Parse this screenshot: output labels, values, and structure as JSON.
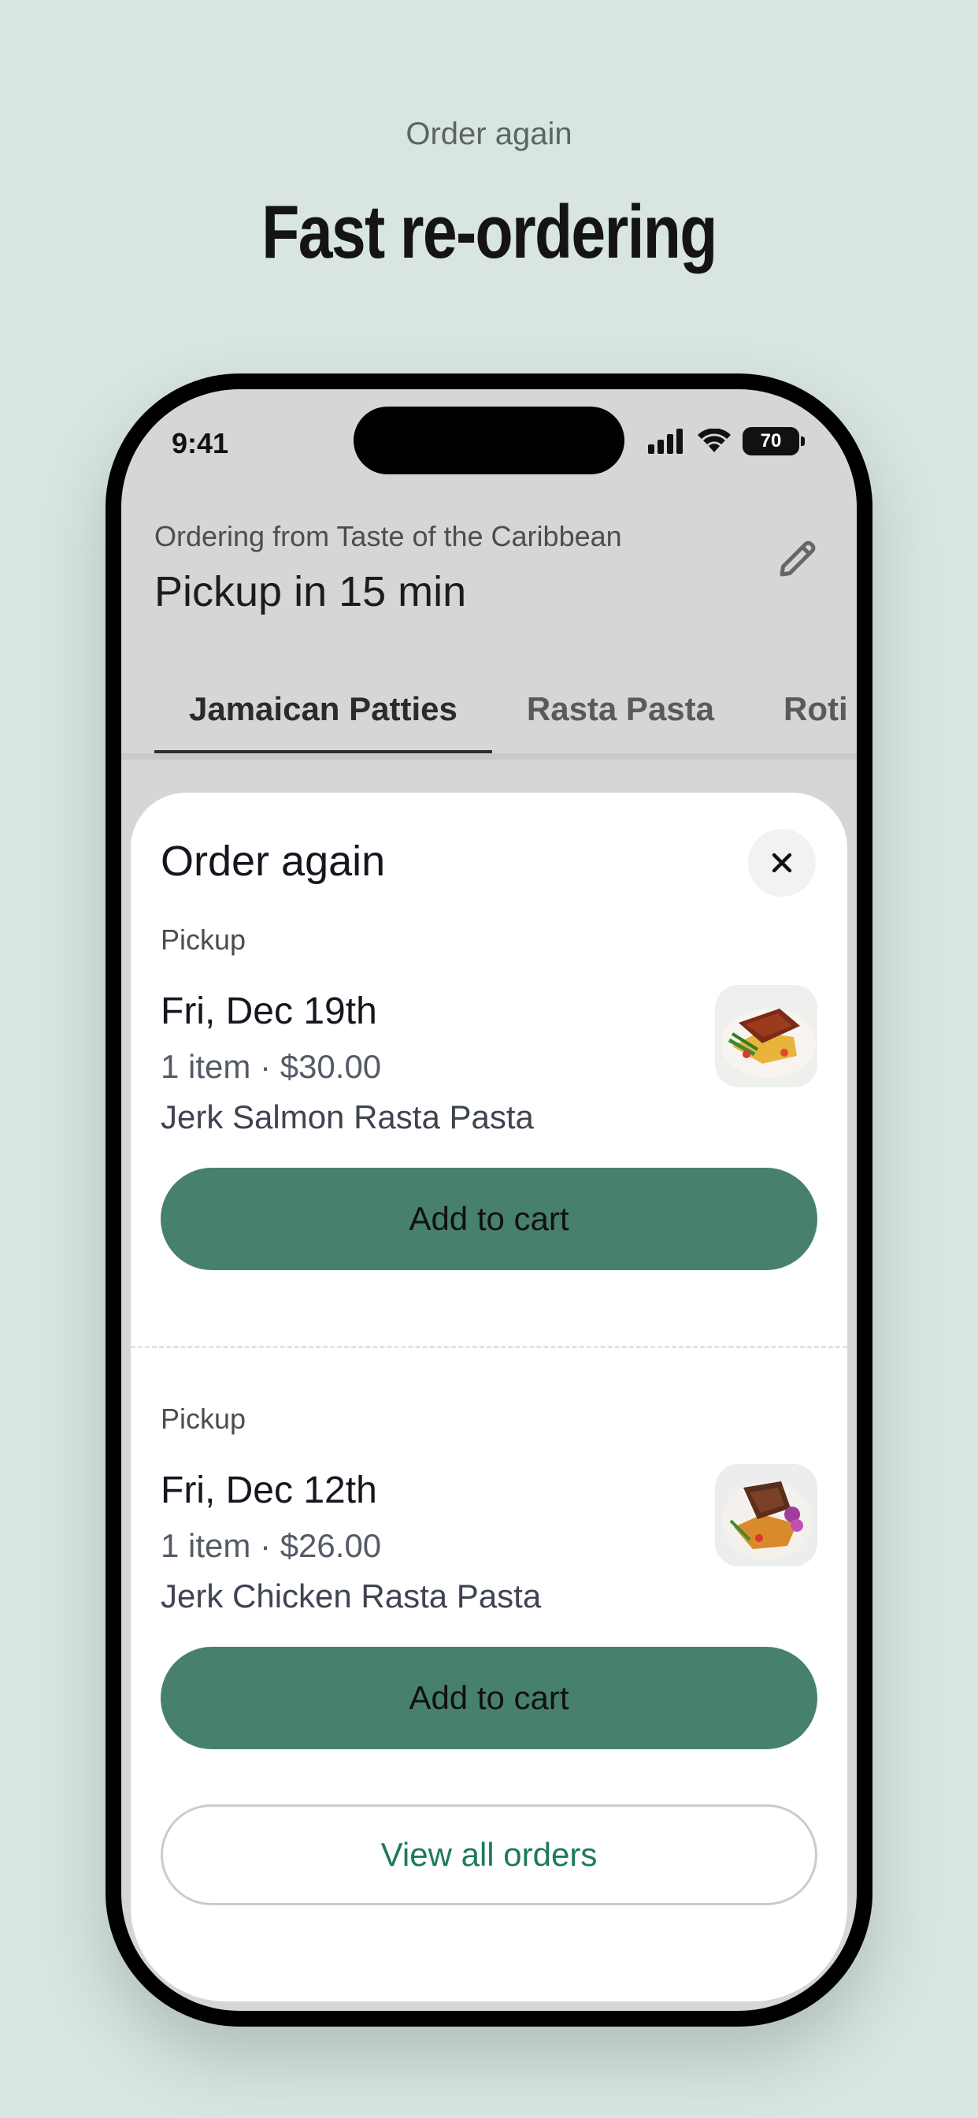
{
  "header": {
    "eyebrow": "Order again",
    "headline": "Fast re-ordering"
  },
  "status_bar": {
    "time": "9:41",
    "battery": "70"
  },
  "store": {
    "ordering_from": "Ordering from Taste of the Caribbean",
    "pickup_title": "Pickup in 15 min"
  },
  "tabs": [
    {
      "label": "Jamaican Patties",
      "active": true
    },
    {
      "label": "Rasta Pasta",
      "active": false
    },
    {
      "label": "Roti",
      "active": false
    }
  ],
  "sheet": {
    "title": "Order again",
    "orders": [
      {
        "type": "Pickup",
        "date": "Fri, Dec 19th",
        "meta": "1 item · $30.00",
        "item": "Jerk Salmon Rasta Pasta",
        "button": "Add to cart"
      },
      {
        "type": "Pickup",
        "date": "Fri, Dec 12th",
        "meta": "1 item · $26.00",
        "item": "Jerk Chicken Rasta Pasta",
        "button": "Add to cart"
      }
    ],
    "view_all": "View all orders"
  },
  "colors": {
    "background": "#d9e5e0",
    "accent": "#47816d",
    "link": "#1d7a5a"
  }
}
